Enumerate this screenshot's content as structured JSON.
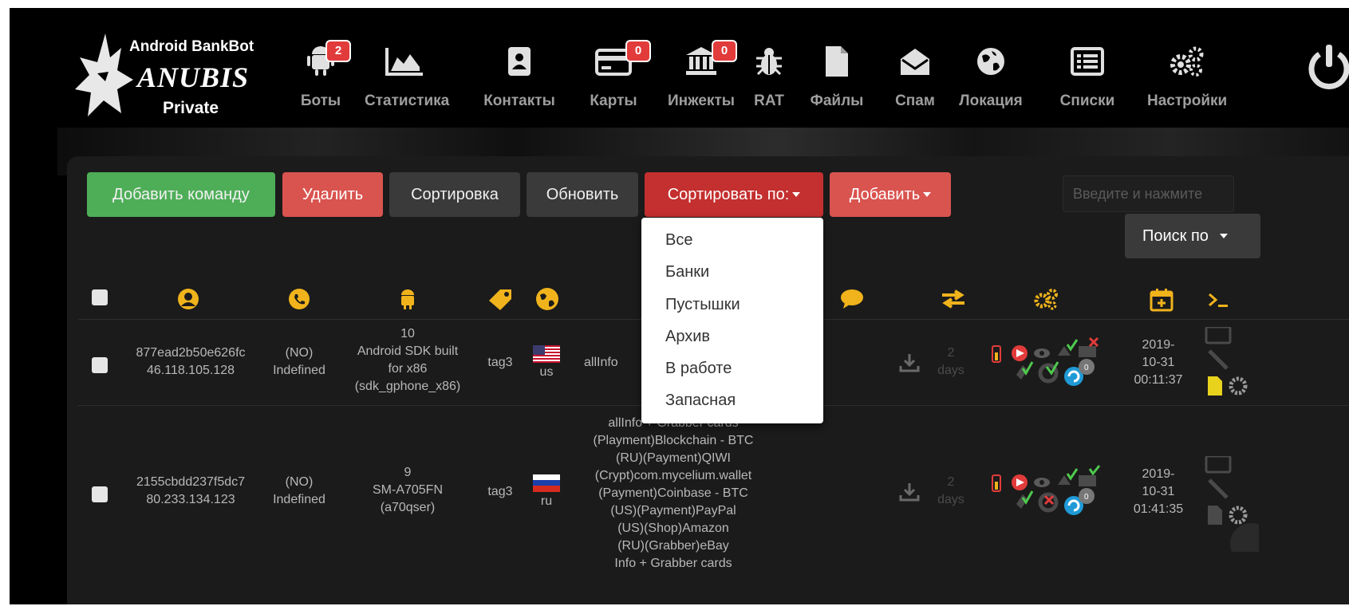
{
  "logo": {
    "line1": "Android BankBot",
    "line2": "ANUBIS",
    "line3": "Private"
  },
  "nav": [
    {
      "label": "Боты",
      "icon": "android-icon",
      "badge": "2"
    },
    {
      "label": "Статистика",
      "icon": "area-chart-icon",
      "badge": ""
    },
    {
      "label": "Контакты",
      "icon": "address-book-icon",
      "badge": ""
    },
    {
      "label": "Карты",
      "icon": "credit-card-icon",
      "badge": "0"
    },
    {
      "label": "Инжекты",
      "icon": "bank-icon",
      "badge": "0"
    },
    {
      "label": "RAT",
      "icon": "bug-icon",
      "badge": ""
    },
    {
      "label": "Файлы",
      "icon": "file-icon",
      "badge": ""
    },
    {
      "label": "Спам",
      "icon": "envelope-open-icon",
      "badge": ""
    },
    {
      "label": "Локация",
      "icon": "globe-icon",
      "badge": ""
    },
    {
      "label": "Списки",
      "icon": "list-icon",
      "badge": ""
    },
    {
      "label": "Настройки",
      "icon": "gears-icon",
      "badge": ""
    }
  ],
  "toolbar": {
    "add_command": "Добавить команду",
    "delete": "Удалить",
    "sorting": "Сортировка",
    "refresh": "Обновить",
    "sort_by": "Сортировать по:",
    "add": "Добавить",
    "search_placeholder": "Введите и нажмите",
    "search_by": "Поиск по"
  },
  "sort_menu": [
    "Все",
    "Банки",
    "Пустышки",
    "Архив",
    "В работе",
    "Запасная"
  ],
  "columns": [
    "select",
    "user-icon",
    "phone-icon",
    "android-icon",
    "tag-icon",
    "globe-icon",
    "comment-icon",
    "exchange-icon",
    "gears-icon",
    "calendar-icon",
    "terminal-icon"
  ],
  "rows": [
    {
      "id": "877ead2b50e626fc",
      "ip": "46.118.105.128",
      "phone_line1": "(NO)",
      "phone_line2": "Indefined",
      "android": [
        "10",
        "Android SDK built",
        "for x86",
        "(sdk_gphone_x86)"
      ],
      "tag": "tag3",
      "country": "us",
      "info": [
        "allInfo"
      ],
      "days_num": "2",
      "days_label": "days",
      "date": [
        "2019-",
        "10-31",
        "00:11:37"
      ]
    },
    {
      "id": "2155cbdd237f5dc7",
      "ip": "80.233.134.123",
      "phone_line1": "(NO)",
      "phone_line2": "Indefined",
      "android": [
        "9",
        "SM-A705FN",
        "(a70qser)"
      ],
      "tag": "tag3",
      "country": "ru",
      "info": [
        "allInfo + Grabber cards",
        "(Playment)Blockchain - BTC",
        "(RU)(Payment)QIWI",
        "(Crypt)com.mycelium.wallet",
        "(Payment)Coinbase - BTC",
        "(US)(Payment)PayPal",
        "(US)(Shop)Amazon",
        "(RU)(Grabber)eBay",
        "Info + Grabber cards"
      ],
      "days_num": "2",
      "days_label": "days",
      "date": [
        "2019-",
        "10-31",
        "01:41:35"
      ]
    }
  ],
  "colors": {
    "accent_yellow": "#f0b31c",
    "green_button": "#4eae58",
    "red_button": "#d9534f",
    "dark_red_button": "#c42f2f",
    "badge": "#e23b3b"
  }
}
